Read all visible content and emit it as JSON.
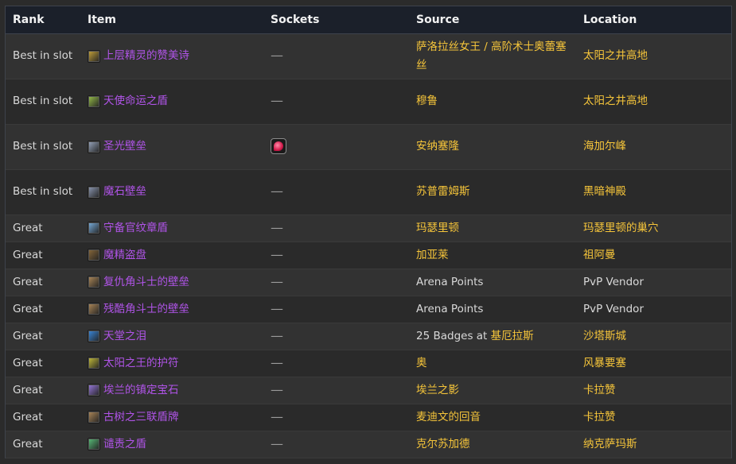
{
  "headers": {
    "rank": "Rank",
    "item": "Item",
    "sockets": "Sockets",
    "source": "Source",
    "location": "Location"
  },
  "rows": [
    {
      "rank": "Best in slot",
      "item": "上层精灵的赞美诗",
      "icon": "book-icon",
      "icon_color": "#c8a43a",
      "socket": "—",
      "source_parts": [
        "萨洛拉丝女王 / 高阶术士奥蕾塞丝"
      ],
      "location": "太阳之井高地"
    },
    {
      "rank": "Best in slot",
      "item": "天使命运之盾",
      "icon": "feather-shield-icon",
      "icon_color": "#9ac24a",
      "socket": "—",
      "source_parts": [
        "穆鲁"
      ],
      "location": "太阳之井高地"
    },
    {
      "rank": "Best in slot",
      "item": "圣光壁垒",
      "icon": "shield-icon",
      "icon_color": "#9aa8c0",
      "socket": "red-gem-icon",
      "source_parts": [
        "安纳塞隆"
      ],
      "location": "海加尔峰"
    },
    {
      "rank": "Best in slot",
      "item": "魔石壁垒",
      "icon": "shield-icon",
      "icon_color": "#8e9ab4",
      "socket": "—",
      "source_parts": [
        "苏普雷姆斯"
      ],
      "location": "黑暗神殿"
    },
    {
      "rank": "Great",
      "item": "守备官纹章盾",
      "icon": "crest-shield-icon",
      "icon_color": "#7ab0e0",
      "socket": "—",
      "source_parts": [
        "玛瑟里顿"
      ],
      "location": "玛瑟里顿的巢穴"
    },
    {
      "rank": "Great",
      "item": "魔精盗盘",
      "icon": "disc-icon",
      "icon_color": "#8a6a3a",
      "socket": "—",
      "source_parts": [
        "加亚莱"
      ],
      "location": "祖阿曼"
    },
    {
      "rank": "Great",
      "item": "复仇角斗士的壁垒",
      "icon": "gladiator-shield-icon",
      "icon_color": "#b08a5a",
      "socket": "—",
      "source_plain": "Arena Points",
      "location_plain": "PvP Vendor"
    },
    {
      "rank": "Great",
      "item": "残酷角斗士的壁垒",
      "icon": "gladiator-shield-icon",
      "icon_color": "#b08a5a",
      "socket": "—",
      "source_plain": "Arena Points",
      "location_plain": "PvP Vendor"
    },
    {
      "rank": "Great",
      "item": "天堂之泪",
      "icon": "orb-icon",
      "icon_color": "#3a8ae0",
      "socket": "—",
      "source_prefix": "25 Badges at ",
      "source_parts": [
        "基厄拉斯"
      ],
      "location": "沙塔斯城"
    },
    {
      "rank": "Great",
      "item": "太阳之王的护符",
      "icon": "charm-icon",
      "icon_color": "#c8c03a",
      "socket": "—",
      "source_parts": [
        "奥"
      ],
      "location": "风暴要塞"
    },
    {
      "rank": "Great",
      "item": "埃兰的镇定宝石",
      "icon": "gem-icon",
      "icon_color": "#9a7ae0",
      "socket": "—",
      "source_parts": [
        "埃兰之影"
      ],
      "location": "卡拉赞"
    },
    {
      "rank": "Great",
      "item": "古树之三联盾牌",
      "icon": "triple-shield-icon",
      "icon_color": "#b08a5a",
      "socket": "—",
      "source_parts": [
        "麦迪文的回音"
      ],
      "location": "卡拉赞"
    },
    {
      "rank": "Great",
      "item": "谴责之盾",
      "icon": "green-shield-icon",
      "icon_color": "#5ac07a",
      "socket": "—",
      "source_parts": [
        "克尔苏加德"
      ],
      "location": "纳克萨玛斯"
    }
  ]
}
